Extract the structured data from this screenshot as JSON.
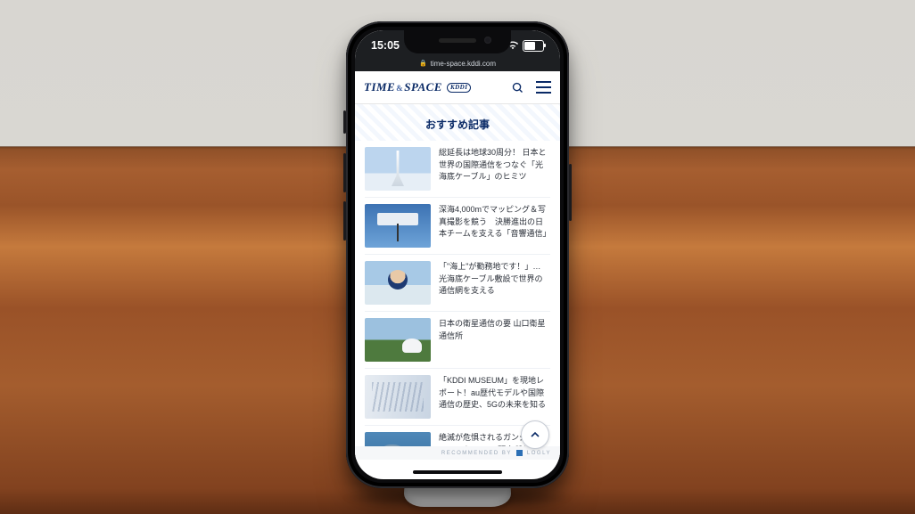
{
  "status": {
    "time": "15:05"
  },
  "browser": {
    "url": "time-space.kddi.com"
  },
  "site": {
    "logo_main1": "TIME",
    "logo_amp": "&",
    "logo_main2": "SPACE",
    "logo_sub": "KDDI"
  },
  "section_title": "おすすめ記事",
  "articles": [
    {
      "title": "総延長は地球30周分！ 日本と世界の国際通信をつなぐ「光海底ケーブル」のヒミツ"
    },
    {
      "title": "深海4,000mでマッピング＆写真撮影を競う　決勝進出の日本チームを支える「音響通信」"
    },
    {
      "title": "「\"海上\"が勤務地です！」… 光海底ケーブル敷設で世界の通信網を支える"
    },
    {
      "title": "日本の衛星通信の要 山口衛星通信所"
    },
    {
      "title": "「KDDI MUSEUM」を現地レポート！au歴代モデルや国際通信の歴史、5Gの未来を知る"
    },
    {
      "title": "絶滅が危惧されるガンジスカワイルカ　KDDI研究所が挑むその取り組み"
    }
  ],
  "footer": {
    "label": "RECOMMENDED BY",
    "brand": "LOGLY"
  }
}
